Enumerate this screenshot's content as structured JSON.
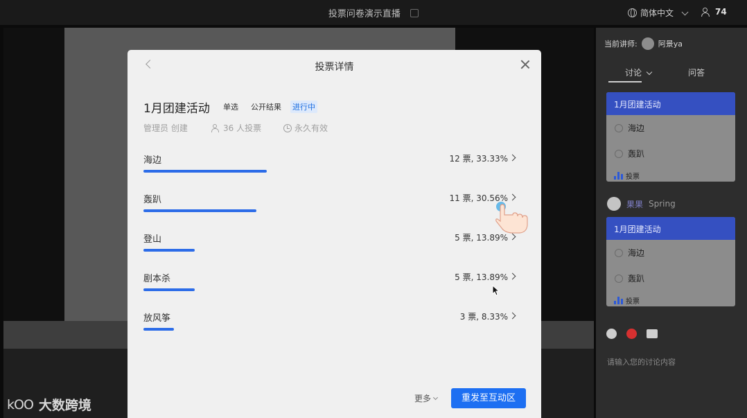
{
  "topbar": {
    "title": "投票问卷演示直播",
    "language": "简体中文",
    "viewer_count": "74"
  },
  "side": {
    "lecturer_label": "当前讲师:",
    "lecturer_name": "阿景ya",
    "tabs": [
      "讨论",
      "问答"
    ],
    "cards": [
      {
        "title": "1月团建活动",
        "options": [
          "海边",
          "轰趴"
        ],
        "footer": "投票"
      },
      {
        "title": "1月团建活动",
        "options": [
          "海边",
          "轰趴"
        ],
        "footer": "投票"
      }
    ],
    "commenter_nick": "果果",
    "commenter_name": "Spring",
    "input_placeholder": "请输入您的讨论内容"
  },
  "modal": {
    "title": "投票详情",
    "poll_title": "1月团建活动",
    "tags": {
      "type": "单选",
      "visibility": "公开结果",
      "status": "进行中"
    },
    "creator": "管理员 创建",
    "voters": "36 人投票",
    "validity": "永久有效",
    "options": [
      {
        "label": "海边",
        "count": "12 票,  33.33%",
        "share": 0.3333
      },
      {
        "label": "轰趴",
        "count": "11 票,  30.56%",
        "share": 0.3056
      },
      {
        "label": "登山",
        "count": "5 票,  13.89%",
        "share": 0.1389
      },
      {
        "label": "剧本杀",
        "count": "5 票,  13.89%",
        "share": 0.1389
      },
      {
        "label": "放风筝",
        "count": "3 票,  8.33%",
        "share": 0.0833
      }
    ],
    "more_label": "更多",
    "resend_label": "重发至互动区"
  },
  "watermark": {
    "logo": "kOO",
    "text": "大数跨境"
  },
  "colors": {
    "accent": "#1d6ff2",
    "card_header": "#3550c1",
    "bar": "#2c6ce8"
  }
}
